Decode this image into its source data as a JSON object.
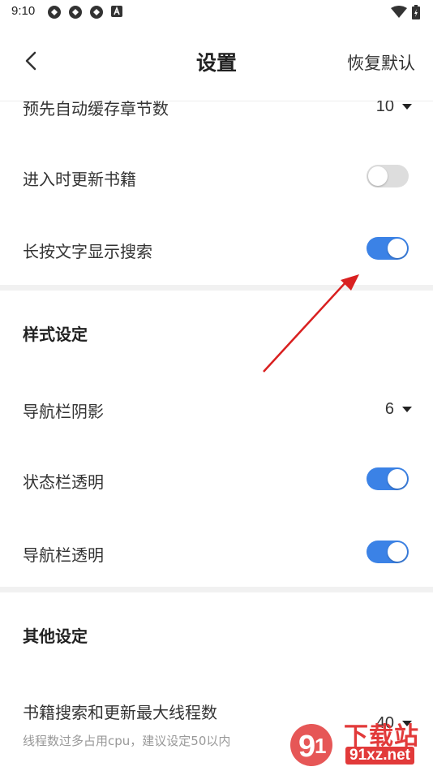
{
  "status_bar": {
    "time": "9:10",
    "icons": [
      "notification-icon",
      "notification-icon",
      "notification-icon",
      "a-icon"
    ],
    "right_icons": [
      "wifi-icon",
      "battery-icon"
    ]
  },
  "header": {
    "title": "设置",
    "restore_label": "恢复默认"
  },
  "rows": {
    "cache_chapters": {
      "label": "预先自动缓存章节数",
      "value": "10"
    },
    "update_on_enter": {
      "label": "进入时更新书籍",
      "on": false
    },
    "long_press_search": {
      "label": "长按文字显示搜索",
      "on": true
    },
    "nav_shadow": {
      "label": "导航栏阴影",
      "value": "6"
    },
    "status_transparent": {
      "label": "状态栏透明",
      "on": true
    },
    "nav_transparent": {
      "label": "导航栏透明",
      "on": true
    },
    "max_threads": {
      "label": "书籍搜索和更新最大线程数",
      "sub": "线程数过多占用cpu，建议设定50以内",
      "value": "40"
    }
  },
  "sections": {
    "style": "样式设定",
    "other": "其他设定"
  },
  "colors": {
    "accent": "#3b82e6",
    "annotation_arrow": "#d92020"
  },
  "watermark": {
    "top": "下载站",
    "bottom": "91xz.net"
  }
}
